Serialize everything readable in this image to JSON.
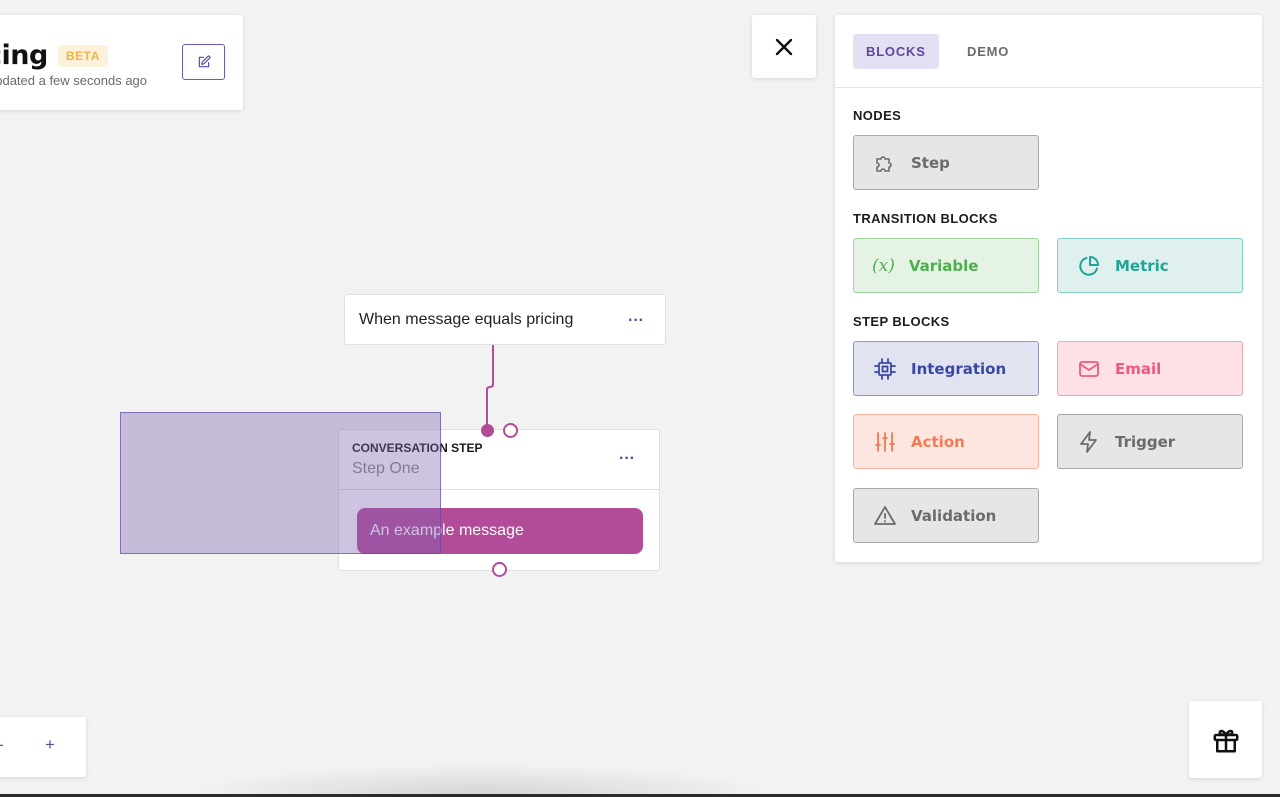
{
  "flow": {
    "title": "cing",
    "badge": "BETA",
    "updated": "updated a few seconds ago"
  },
  "panel": {
    "tabs": [
      {
        "label": "BLOCKS",
        "active": true
      },
      {
        "label": "DEMO",
        "active": false
      }
    ],
    "sections": {
      "nodes": "NODES",
      "transition": "TRANSITION BLOCKS",
      "step": "STEP BLOCKS"
    },
    "blocks": {
      "step": {
        "label": "Step",
        "icon": "puzzle-icon"
      },
      "variable": {
        "label": "Variable",
        "icon": "variable-icon",
        "glyph": "(x)"
      },
      "metric": {
        "label": "Metric",
        "icon": "pie-chart-icon"
      },
      "integration": {
        "label": "Integration",
        "icon": "chip-icon"
      },
      "email": {
        "label": "Email",
        "icon": "mail-icon"
      },
      "action": {
        "label": "Action",
        "icon": "sliders-icon"
      },
      "trigger": {
        "label": "Trigger",
        "icon": "lightning-icon"
      },
      "validation": {
        "label": "Validation",
        "icon": "warning-icon"
      }
    }
  },
  "canvas": {
    "transition": {
      "text": "When message equals pricing",
      "menu": "···"
    },
    "step": {
      "type": "CONVERSATION STEP",
      "name": "Step One",
      "menu": "···",
      "message": "An example message"
    }
  },
  "zoom": {
    "minus": "-",
    "plus": "+"
  },
  "colors": {
    "accent": "#5d479f",
    "message": "#b24b98",
    "background": "#f2f2f2"
  }
}
